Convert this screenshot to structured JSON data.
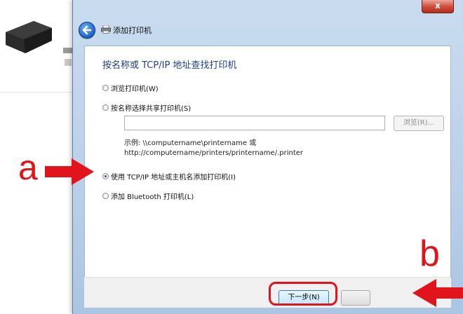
{
  "dialog": {
    "close_label": "x",
    "title": "添加打印机",
    "heading": "按名称或 TCP/IP 地址查找打印机"
  },
  "options": [
    {
      "label": "浏览打印机(W)",
      "checked": false
    },
    {
      "label": "按名称选择共享打印机(S)",
      "checked": false
    },
    {
      "label": "使用 TCP/IP 地址或主机名添加打印机(I)",
      "checked": true
    },
    {
      "label": "添加 Bluetooth 打印机(L)",
      "checked": false
    }
  ],
  "share_input": {
    "value": ""
  },
  "browse_label": "浏览(R)...",
  "example": {
    "line1": "示例: \\\\computername\\printername 或",
    "line2": "http://computername/printers/printername/.printer"
  },
  "next_label": "下一步(N)",
  "annotations": {
    "a": "a",
    "b": "b"
  },
  "colors": {
    "annotation": "#e0141a",
    "heading": "#1e3e87"
  }
}
